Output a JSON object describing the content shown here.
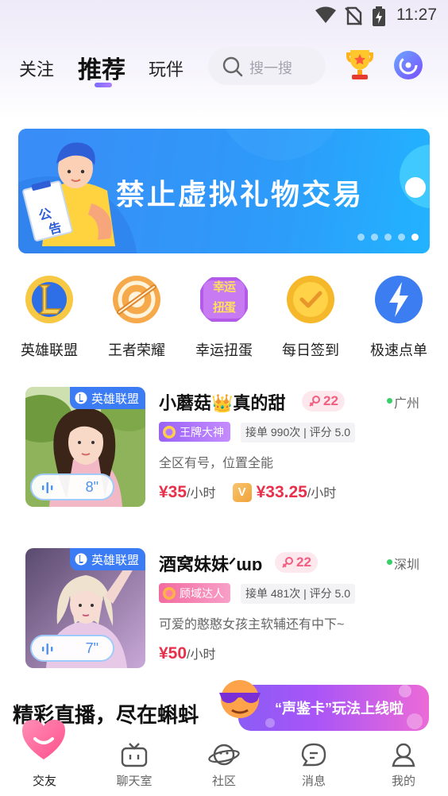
{
  "status_bar": {
    "time": "11:27"
  },
  "top_nav": {
    "tabs": [
      "关注",
      "推荐",
      "玩伴"
    ],
    "active_tab": "推荐",
    "search_placeholder": "搜一搜"
  },
  "banner": {
    "text": "禁止虚拟礼物交易",
    "figure_sign": "公告",
    "dots": 5,
    "active_dot": 5
  },
  "quick_entries": [
    {
      "label": "英雄联盟",
      "icon": "lol-icon"
    },
    {
      "label": "王者荣耀",
      "icon": "honor-of-kings-icon"
    },
    {
      "label": "幸运扭蛋",
      "icon": "lucky-capsule-icon",
      "icon_text": "幸运扭蛋"
    },
    {
      "label": "每日签到",
      "icon": "checkin-icon"
    },
    {
      "label": "极速点单",
      "icon": "lightning-icon"
    }
  ],
  "players": [
    {
      "game_tag": "英雄联盟",
      "voice_duration": "8\"",
      "name": "小蘑菇👑真的甜",
      "gender_age": "22",
      "city": "广州",
      "rank_badge": "王牌大神",
      "stats": "接单 990次 | 评分 5.0",
      "description": "全区有号，位置全能",
      "price": "¥35",
      "price_unit": "/小时",
      "vip_label": "V",
      "vip_price": "¥33.25",
      "vip_price_unit": "/小时"
    },
    {
      "game_tag": "英雄联盟",
      "voice_duration": "7\"",
      "name": "酒窝妹妹ᐟɯɒ",
      "gender_age": "22",
      "city": "深圳",
      "rank_badge": "顾域达人",
      "stats": "接单 481次 | 评分 5.0",
      "description": "可爱的憨憨女孩主软辅还有中下~",
      "price": "¥50",
      "price_unit": "/小时"
    }
  ],
  "live_section": {
    "title": "精彩直播，尽在蝌蚪",
    "promo_text": "“声鉴卡”玩法上线啦"
  },
  "bottom_nav": [
    {
      "label": "交友",
      "icon": "heart-icon",
      "active": true
    },
    {
      "label": "聊天室",
      "icon": "tv-icon",
      "active": false
    },
    {
      "label": "社区",
      "icon": "planet-icon",
      "active": false
    },
    {
      "label": "消息",
      "icon": "message-icon",
      "active": false
    },
    {
      "label": "我的",
      "icon": "profile-icon",
      "active": false
    }
  ],
  "colors": {
    "accent": "#7b6cff",
    "banner_blue": "#2e9af9",
    "price_red": "#e8304a",
    "game_tag_blue": "#3b7cf5",
    "online_green": "#39d06a",
    "gender_pink": "#f35d7f"
  }
}
